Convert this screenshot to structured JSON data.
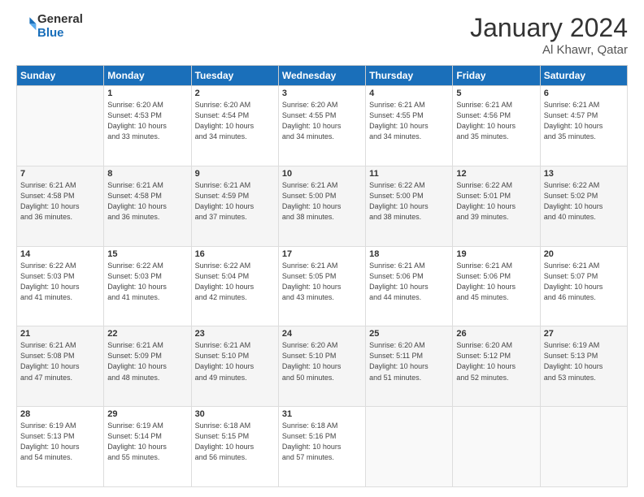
{
  "header": {
    "logo_line1": "General",
    "logo_line2": "Blue",
    "title": "January 2024",
    "subtitle": "Al Khawr, Qatar"
  },
  "weekdays": [
    "Sunday",
    "Monday",
    "Tuesday",
    "Wednesday",
    "Thursday",
    "Friday",
    "Saturday"
  ],
  "weeks": [
    [
      {
        "num": "",
        "info": ""
      },
      {
        "num": "1",
        "info": "Sunrise: 6:20 AM\nSunset: 4:53 PM\nDaylight: 10 hours\nand 33 minutes."
      },
      {
        "num": "2",
        "info": "Sunrise: 6:20 AM\nSunset: 4:54 PM\nDaylight: 10 hours\nand 34 minutes."
      },
      {
        "num": "3",
        "info": "Sunrise: 6:20 AM\nSunset: 4:55 PM\nDaylight: 10 hours\nand 34 minutes."
      },
      {
        "num": "4",
        "info": "Sunrise: 6:21 AM\nSunset: 4:55 PM\nDaylight: 10 hours\nand 34 minutes."
      },
      {
        "num": "5",
        "info": "Sunrise: 6:21 AM\nSunset: 4:56 PM\nDaylight: 10 hours\nand 35 minutes."
      },
      {
        "num": "6",
        "info": "Sunrise: 6:21 AM\nSunset: 4:57 PM\nDaylight: 10 hours\nand 35 minutes."
      }
    ],
    [
      {
        "num": "7",
        "info": "Sunrise: 6:21 AM\nSunset: 4:58 PM\nDaylight: 10 hours\nand 36 minutes."
      },
      {
        "num": "8",
        "info": "Sunrise: 6:21 AM\nSunset: 4:58 PM\nDaylight: 10 hours\nand 36 minutes."
      },
      {
        "num": "9",
        "info": "Sunrise: 6:21 AM\nSunset: 4:59 PM\nDaylight: 10 hours\nand 37 minutes."
      },
      {
        "num": "10",
        "info": "Sunrise: 6:21 AM\nSunset: 5:00 PM\nDaylight: 10 hours\nand 38 minutes."
      },
      {
        "num": "11",
        "info": "Sunrise: 6:22 AM\nSunset: 5:00 PM\nDaylight: 10 hours\nand 38 minutes."
      },
      {
        "num": "12",
        "info": "Sunrise: 6:22 AM\nSunset: 5:01 PM\nDaylight: 10 hours\nand 39 minutes."
      },
      {
        "num": "13",
        "info": "Sunrise: 6:22 AM\nSunset: 5:02 PM\nDaylight: 10 hours\nand 40 minutes."
      }
    ],
    [
      {
        "num": "14",
        "info": "Sunrise: 6:22 AM\nSunset: 5:03 PM\nDaylight: 10 hours\nand 41 minutes."
      },
      {
        "num": "15",
        "info": "Sunrise: 6:22 AM\nSunset: 5:03 PM\nDaylight: 10 hours\nand 41 minutes."
      },
      {
        "num": "16",
        "info": "Sunrise: 6:22 AM\nSunset: 5:04 PM\nDaylight: 10 hours\nand 42 minutes."
      },
      {
        "num": "17",
        "info": "Sunrise: 6:21 AM\nSunset: 5:05 PM\nDaylight: 10 hours\nand 43 minutes."
      },
      {
        "num": "18",
        "info": "Sunrise: 6:21 AM\nSunset: 5:06 PM\nDaylight: 10 hours\nand 44 minutes."
      },
      {
        "num": "19",
        "info": "Sunrise: 6:21 AM\nSunset: 5:06 PM\nDaylight: 10 hours\nand 45 minutes."
      },
      {
        "num": "20",
        "info": "Sunrise: 6:21 AM\nSunset: 5:07 PM\nDaylight: 10 hours\nand 46 minutes."
      }
    ],
    [
      {
        "num": "21",
        "info": "Sunrise: 6:21 AM\nSunset: 5:08 PM\nDaylight: 10 hours\nand 47 minutes."
      },
      {
        "num": "22",
        "info": "Sunrise: 6:21 AM\nSunset: 5:09 PM\nDaylight: 10 hours\nand 48 minutes."
      },
      {
        "num": "23",
        "info": "Sunrise: 6:21 AM\nSunset: 5:10 PM\nDaylight: 10 hours\nand 49 minutes."
      },
      {
        "num": "24",
        "info": "Sunrise: 6:20 AM\nSunset: 5:10 PM\nDaylight: 10 hours\nand 50 minutes."
      },
      {
        "num": "25",
        "info": "Sunrise: 6:20 AM\nSunset: 5:11 PM\nDaylight: 10 hours\nand 51 minutes."
      },
      {
        "num": "26",
        "info": "Sunrise: 6:20 AM\nSunset: 5:12 PM\nDaylight: 10 hours\nand 52 minutes."
      },
      {
        "num": "27",
        "info": "Sunrise: 6:19 AM\nSunset: 5:13 PM\nDaylight: 10 hours\nand 53 minutes."
      }
    ],
    [
      {
        "num": "28",
        "info": "Sunrise: 6:19 AM\nSunset: 5:13 PM\nDaylight: 10 hours\nand 54 minutes."
      },
      {
        "num": "29",
        "info": "Sunrise: 6:19 AM\nSunset: 5:14 PM\nDaylight: 10 hours\nand 55 minutes."
      },
      {
        "num": "30",
        "info": "Sunrise: 6:18 AM\nSunset: 5:15 PM\nDaylight: 10 hours\nand 56 minutes."
      },
      {
        "num": "31",
        "info": "Sunrise: 6:18 AM\nSunset: 5:16 PM\nDaylight: 10 hours\nand 57 minutes."
      },
      {
        "num": "",
        "info": ""
      },
      {
        "num": "",
        "info": ""
      },
      {
        "num": "",
        "info": ""
      }
    ]
  ]
}
